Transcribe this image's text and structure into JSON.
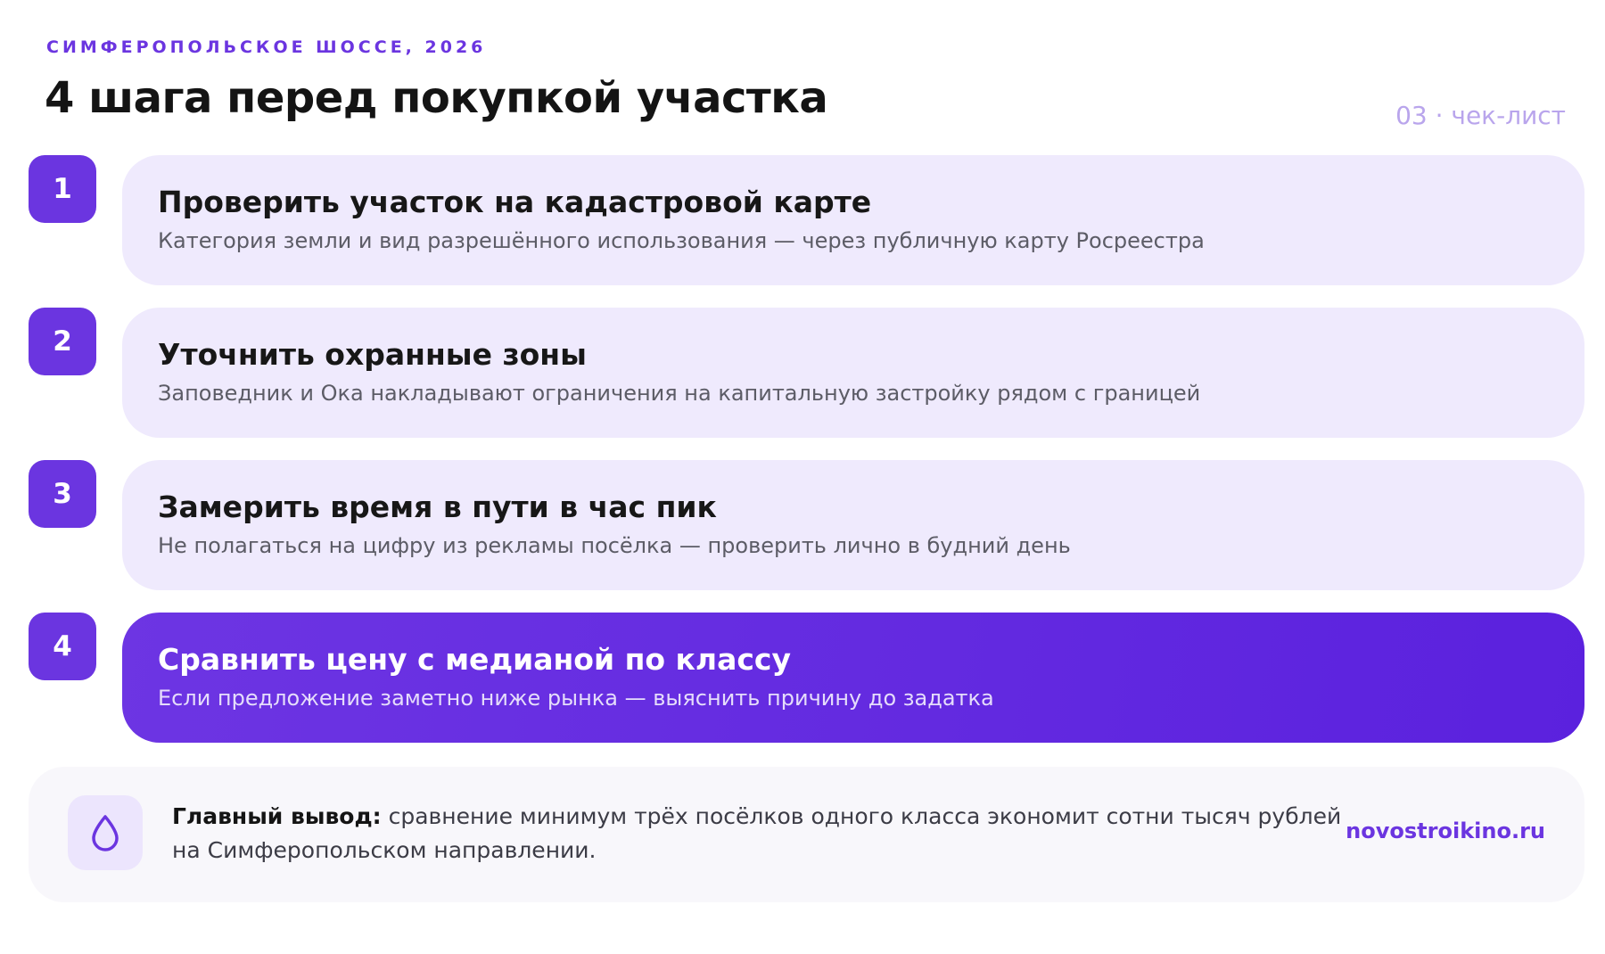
{
  "header": {
    "kicker": "СИМФЕРОПОЛЬСКОЕ ШОССЕ, 2026",
    "title": "4 шага перед покупкой участка",
    "page_tag": "03 · чек-лист"
  },
  "steps": [
    {
      "number": "1",
      "title": "Проверить участок на кадастровой карте",
      "description": "Категория земли и вид разрешённого использования — через публичную карту Росреестра",
      "highlighted": false
    },
    {
      "number": "2",
      "title": "Уточнить охранные зоны",
      "description": "Заповедник и Ока накладывают ограничения на капитальную застройку рядом с границей",
      "highlighted": false
    },
    {
      "number": "3",
      "title": "Замерить время в пути в час пик",
      "description": "Не полагаться на цифру из рекламы посёлка — проверить лично в будний день",
      "highlighted": false
    },
    {
      "number": "4",
      "title": "Сравнить цену с медианой по классу",
      "description": "Если предложение заметно ниже рынка — выяснить причину до задатка",
      "highlighted": true
    }
  ],
  "summary": {
    "icon": "drop-icon",
    "label": "Главный вывод:",
    "text": " сравнение минимум трёх посёлков одного класса экономит сотни тысяч рублей на Симферопольском направлении.",
    "link": "novostroikino.ru"
  },
  "colors": {
    "accent": "#6b35e0",
    "card_bg": "#efeafd",
    "active_card": "#5b21de",
    "summary_bg": "#f8f7fb"
  }
}
